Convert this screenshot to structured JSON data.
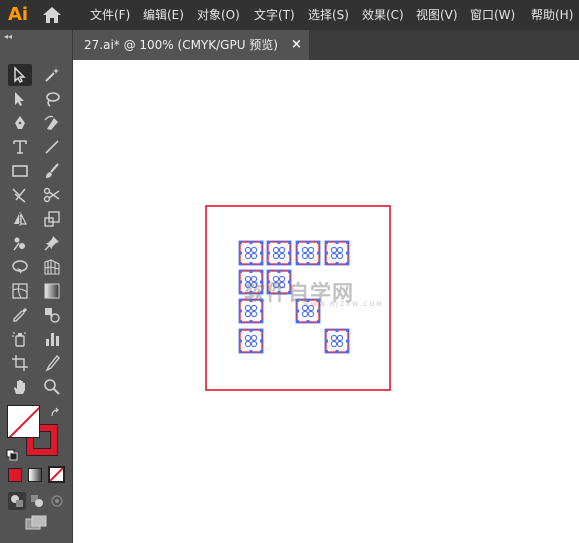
{
  "app": {
    "logo_text": "Ai"
  },
  "menu": [
    "文件(F)",
    "编辑(E)",
    "对象(O)",
    "文字(T)",
    "选择(S)",
    "效果(C)",
    "视图(V)",
    "窗口(W)",
    "帮助(H)"
  ],
  "document": {
    "tab_title": "27.ai* @ 100% (CMYK/GPU 预览)",
    "close_label": "×"
  },
  "toolbar": {
    "collapse_label": "◂◂",
    "tools": [
      "selection-tool",
      "magic-wand-tool",
      "direct-selection-tool",
      "lasso-tool",
      "pen-tool",
      "curvature-tool",
      "type-tool",
      "line-segment-tool",
      "rectangle-tool",
      "paintbrush-tool",
      "shaper-tool",
      "scissors-tool",
      "reflect-tool",
      "scale-tool",
      "puppet-warp-tool",
      "pin-tool",
      "free-transform-tool",
      "perspective-grid-tool",
      "mesh-tool",
      "gradient-tool",
      "eyedropper-tool",
      "blend-tool",
      "symbol-sprayer-tool",
      "column-graph-tool",
      "artboard-tool",
      "slice-tool",
      "hand-tool",
      "zoom-tool"
    ],
    "fill_color": "#ffffff",
    "stroke_color": "#e0182d"
  },
  "canvas": {
    "artboard_color": "#ffffff",
    "selection_color": "#4a6cf7",
    "frame_color": "#e0182d",
    "watermark": "软件自学网",
    "watermark_sub": "WWW.RJZXW.COM"
  }
}
